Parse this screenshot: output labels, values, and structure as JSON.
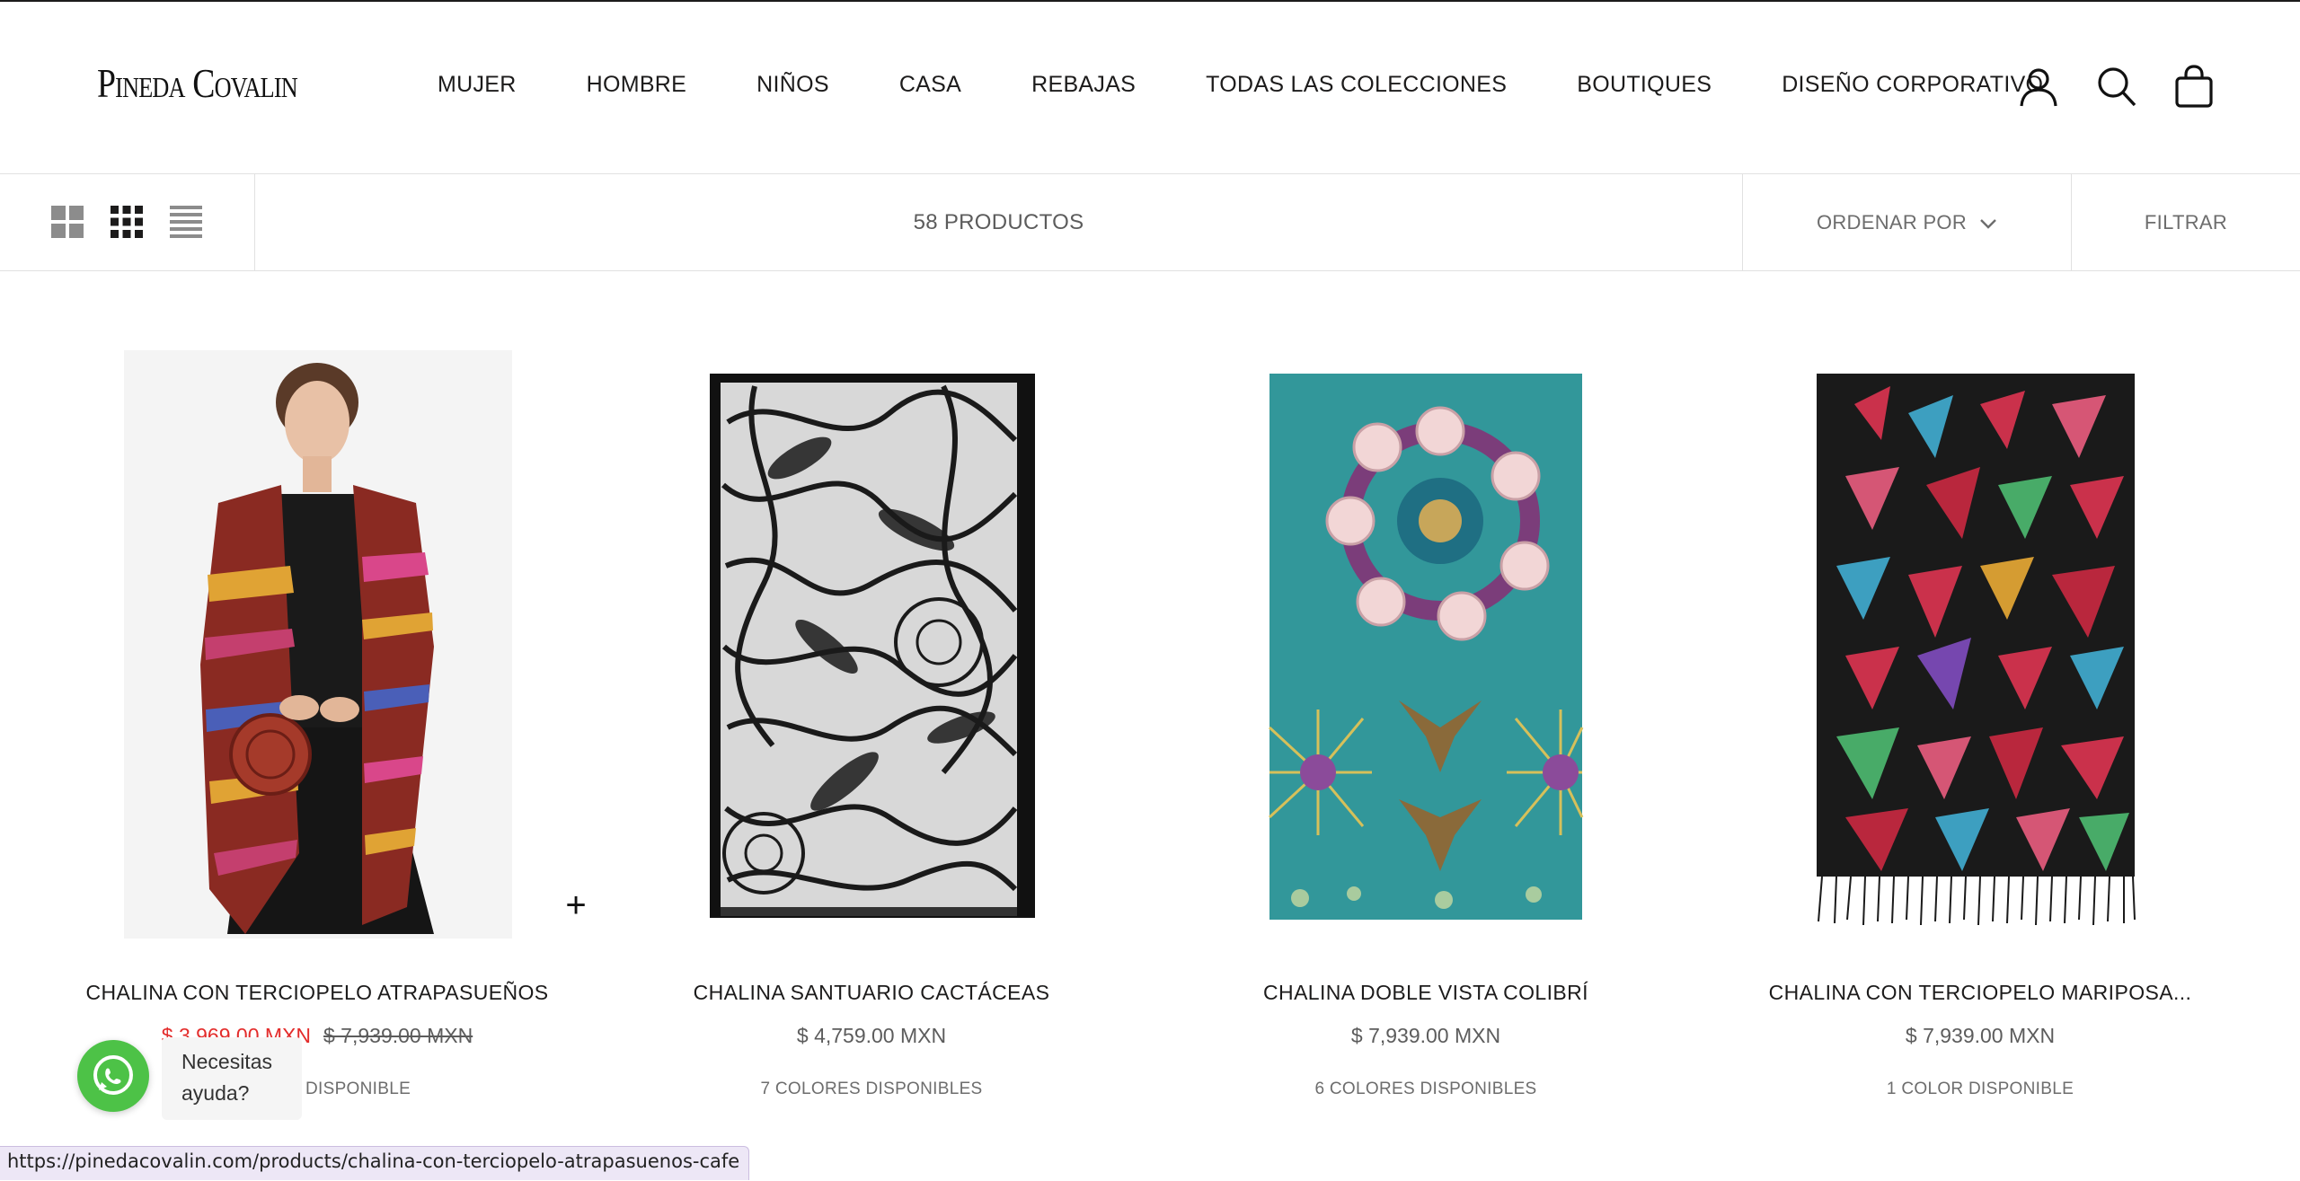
{
  "brand": {
    "logo_text": "Pineda Covalin"
  },
  "nav": {
    "items": [
      {
        "label": "MUJER"
      },
      {
        "label": "HOMBRE"
      },
      {
        "label": "NIÑOS"
      },
      {
        "label": "CASA"
      },
      {
        "label": "REBAJAS"
      },
      {
        "label": "TODAS LAS COLECCIONES"
      },
      {
        "label": "BOUTIQUES"
      },
      {
        "label": "DISEÑO CORPORATIVO"
      }
    ]
  },
  "header_icons": [
    "account-icon",
    "search-icon",
    "cart-icon"
  ],
  "toolbar": {
    "product_count": "58 PRODUCTOS",
    "sort_label": "ORDENAR POR",
    "filter_label": "FILTRAR"
  },
  "products": [
    {
      "title": "CHALINA CON TERCIOPELO ATRAPASUEÑOS",
      "sale_price": "$ 3,969.00 MXN",
      "price": "$ 7,939.00 MXN",
      "colors": "1 COLOR DISPONIBLE"
    },
    {
      "title": "CHALINA SANTUARIO CACTÁCEAS",
      "price": "$ 4,759.00 MXN",
      "colors": "7 COLORES DISPONIBLES"
    },
    {
      "title": "CHALINA DOBLE VISTA COLIBRÍ",
      "price": "$ 7,939.00 MXN",
      "colors": "6 COLORES DISPONIBLES"
    },
    {
      "title": "CHALINA CON TERCIOPELO MARIPOSA...",
      "price": "$ 7,939.00 MXN",
      "colors": "1 COLOR DISPONIBLE"
    }
  ],
  "quick_add": "+",
  "whatsapp": {
    "text": "Necesitas ayuda?"
  },
  "status_url": "https://pinedacovalin.com/products/chalina-con-terciopelo-atrapasuenos-cafe",
  "colors": {
    "sale": "#e32c2b",
    "whatsapp": "#4dc247",
    "text": "#1c1b1b"
  }
}
